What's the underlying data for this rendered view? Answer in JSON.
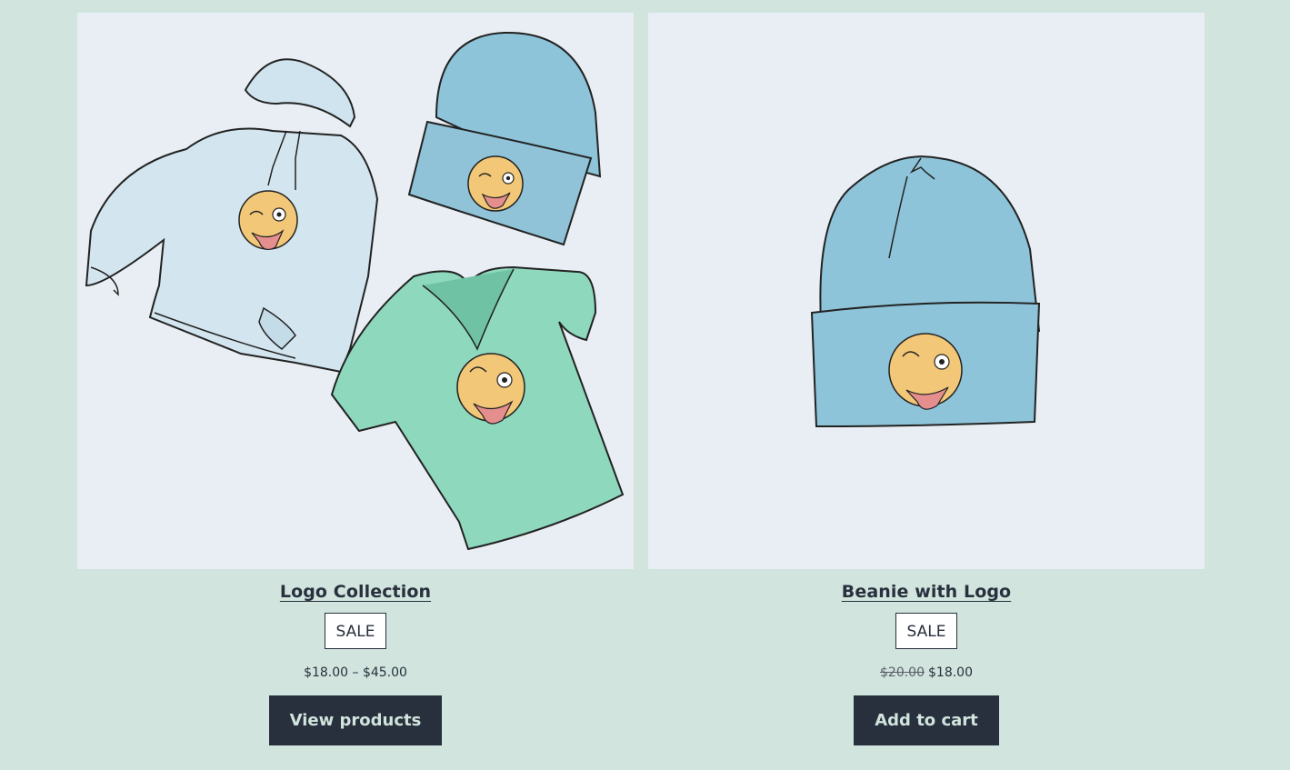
{
  "products": [
    {
      "title": "Logo Collection",
      "badge": "SALE",
      "price": "$18.00 – $45.00",
      "button": "View products",
      "image": "hoodie-beanie-tshirt-illustration"
    },
    {
      "title": "Beanie with Logo",
      "badge": "SALE",
      "old_price": "$20.00",
      "new_price": "$18.00",
      "button": "Add to cart",
      "image": "beanie-illustration"
    }
  ],
  "colors": {
    "background": "#d1e4dd",
    "image_bg": "#e8eef3",
    "button_bg": "#28303d",
    "button_text": "#d1e4dd",
    "text": "#28303d"
  }
}
